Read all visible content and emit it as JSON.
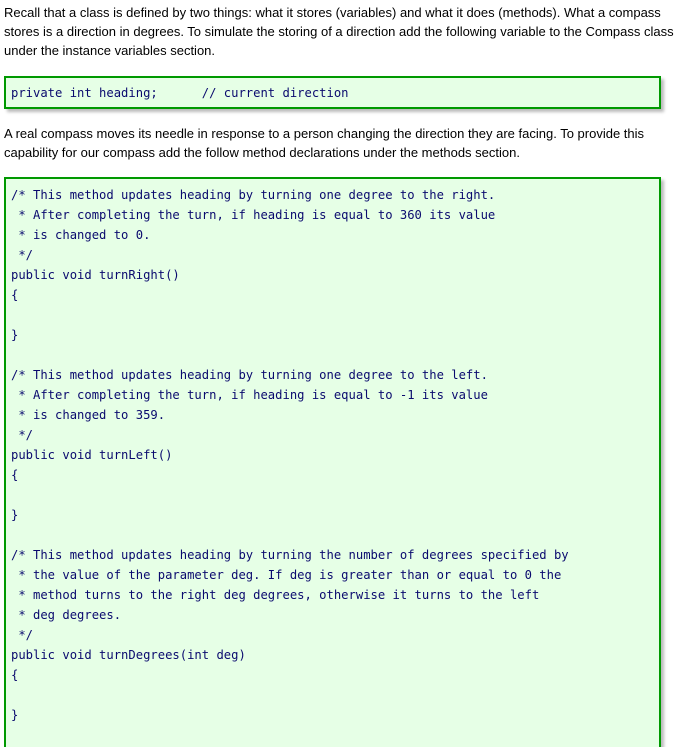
{
  "intro_paragraph": "Recall that a class is defined by two things: what it stores (variables) and what it does (methods). What a compass stores is a direction in degrees. To simulate the storing of a direction add the following variable to the Compass class under the instance variables section.",
  "variable_code": "private int heading;      // current direction",
  "methods_paragraph": "A real compass moves its needle in response to a person changing the direction they are facing. To provide this capability for our compass add the follow method declarations under the methods section.",
  "methods_code": "/* This method updates heading by turning one degree to the right.\n * After completing the turn, if heading is equal to 360 its value\n * is changed to 0.\n */\npublic void turnRight()\n{\n\n}\n\n/* This method updates heading by turning one degree to the left.\n * After completing the turn, if heading is equal to -1 its value\n * is changed to 359.\n */\npublic void turnLeft()\n{\n\n}\n\n/* This method updates heading by turning the number of degrees specified by\n * the value of the parameter deg. If deg is greater than or equal to 0 the\n * method turns to the right deg degrees, otherwise it turns to the left\n * deg degrees.\n */\npublic void turnDegrees(int deg)\n{\n\n}"
}
